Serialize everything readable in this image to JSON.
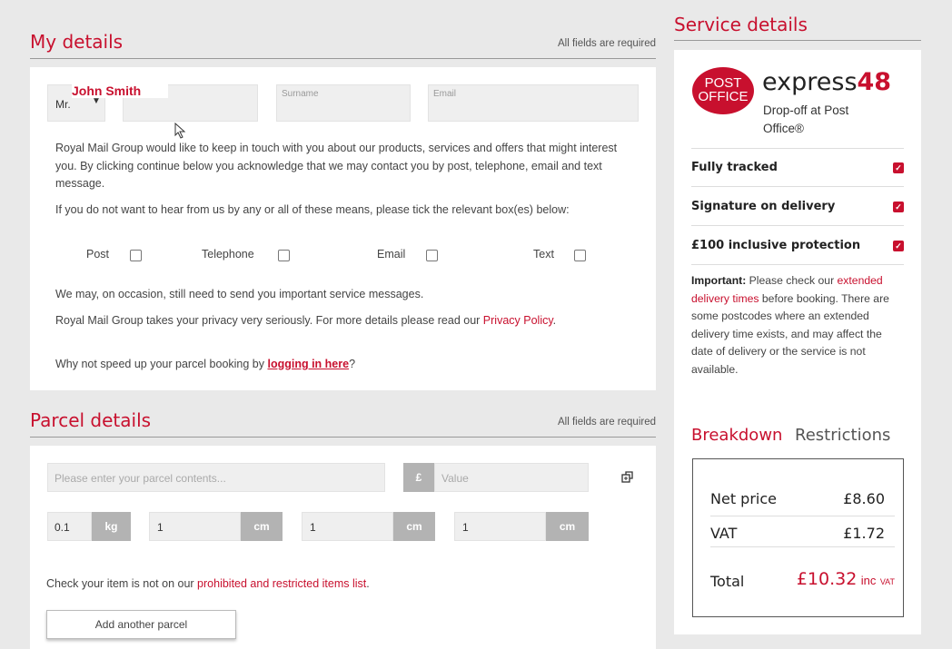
{
  "my_details": {
    "title": "My details",
    "required_note": "All fields are required",
    "title_select": "Mr.",
    "name_value": "John Smith",
    "surname_placeholder": "Surname",
    "email_placeholder": "Email",
    "marketing_text": "Royal Mail Group would like to keep in touch with you about our products, services and offers that might interest you. By clicking continue below you acknowledge that we may contact you by post, telephone, email and text message.",
    "optout_text": "If you do not want to hear from us by any or all of these means, please tick the relevant box(es) below:",
    "channels": [
      "Post",
      "Telephone",
      "Email",
      "Text"
    ],
    "service_msg": "We may, on occasion, still need to send you important service messages.",
    "privacy_text": "Royal Mail Group takes your privacy very seriously. For more details please read our ",
    "privacy_link": "Privacy Policy",
    "privacy_end": ".",
    "login_text": "Why not speed up your parcel booking by ",
    "login_link": "logging in here",
    "login_end": "?"
  },
  "parcel_details": {
    "title": "Parcel details",
    "required_note": "All fields are required",
    "contents_placeholder": "Please enter your parcel contents...",
    "currency_symbol": "£",
    "value_placeholder": "Value",
    "weight_value": "0.1",
    "weight_unit": "kg",
    "dimensions": [
      {
        "value": "1",
        "unit": "cm"
      },
      {
        "value": "1",
        "unit": "cm"
      },
      {
        "value": "1",
        "unit": "cm"
      }
    ],
    "check_text": "Check your item is not on our ",
    "check_link": "prohibited and restricted items list",
    "check_end": ".",
    "add_parcel_label": "Add another parcel"
  },
  "service": {
    "title": "Service details",
    "logo_line1": "POST",
    "logo_line2": "OFFICE",
    "product_name": "express",
    "product_num": "48",
    "product_sub": "Drop-off at Post Office®",
    "features": [
      "Fully tracked",
      "Signature on delivery",
      "£100 inclusive protection"
    ],
    "important_label": "Important:",
    "important_pre": " Please check our ",
    "important_link": "extended delivery times",
    "important_post": " before booking. There are some postcodes where an extended delivery time exists, and may affect the date of delivery or the service is not available.",
    "tabs": [
      "Breakdown",
      "Restrictions"
    ],
    "breakdown": {
      "net_label": "Net price",
      "net_value": "£8.60",
      "vat_label": "VAT",
      "vat_value": "£1.72",
      "total_label": "Total",
      "total_value": "£10.32",
      "total_suffix_inc": "inc",
      "total_suffix_vat": "VAT"
    }
  },
  "colors": {
    "accent": "#c8102e",
    "background": "#e9e9e9",
    "field": "#efefef",
    "unit_box": "#b3b3b3"
  }
}
